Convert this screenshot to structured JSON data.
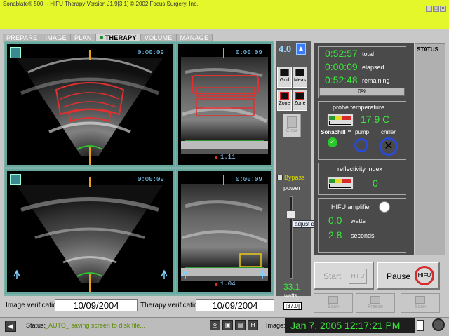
{
  "window": {
    "title": "Sonablate® 500 -- HIFU Therapy  Version J1.9[3.1]  © 2002 Focus Surgery, Inc.",
    "controls": [
      "_",
      "□",
      "×"
    ]
  },
  "tabs": [
    {
      "label": "PREPARE",
      "active": false
    },
    {
      "label": "IMAGE",
      "active": false
    },
    {
      "label": "PLAN",
      "active": false
    },
    {
      "label": "THERAPY",
      "active": true
    },
    {
      "label": "VOLUME",
      "active": false
    },
    {
      "label": "MANAGE",
      "active": false
    }
  ],
  "views": {
    "top_left": {
      "timer": "0:00:09"
    },
    "top_right": {
      "timer": "0:00:09",
      "depth": "1.11"
    },
    "bottom_left": {
      "timer": "0:00:09"
    },
    "bottom_right": {
      "timer": "0:00:09",
      "depth": "1.04"
    }
  },
  "tools": {
    "scale": "4.0",
    "grid_label": "Grid",
    "meas_label": "Meas",
    "zone1_label": "Zone",
    "zone2_label": "Zone",
    "clear_label": "Clear",
    "bypass_label": "Bypass",
    "power_label": "power",
    "power_value": "33.1",
    "watts_label": "watts",
    "power_setting": "[37.0]",
    "slider_level_percent": 81,
    "tooltip": "adjust dosage"
  },
  "verification": {
    "image_label": "Image verification",
    "image_date": "10/09/2004",
    "therapy_label": "Therapy verification",
    "therapy_date": "10/09/2004"
  },
  "timing": {
    "total_time": "0:52:57",
    "total_label": "total",
    "elapsed_time": "0:00:09",
    "elapsed_label": "elapsed",
    "remaining_time": "0:52:48",
    "remaining_label": "remaining",
    "progress_text": "0%",
    "progress_percent": 0
  },
  "probe": {
    "title": "probe temperature",
    "temperature": "17.9 C",
    "sonachill_label": "Sonachill™",
    "pump_label": "pump",
    "chiller_label": "chiller"
  },
  "reflectivity": {
    "title": "reflectivity index",
    "value": "0"
  },
  "hifu": {
    "title": "HIFU amplifier",
    "watts_value": "0.0",
    "watts_label": "watts",
    "seconds_value": "2.8",
    "seconds_label": "seconds"
  },
  "status_panel": {
    "title": "STATUS"
  },
  "actions": {
    "start_label": "Start",
    "start_icon_text": "HIFU",
    "pause_label": "Pause",
    "pause_icon_text": "HIFU",
    "scan1_label": "Scan",
    "freeze_label": "Freeze",
    "scan2_label": "Scan"
  },
  "statusbar": {
    "status_label": "Status:",
    "status_message": "_AUTO_ saving screen to disk file...",
    "image_label": "Image:",
    "image_time": "Jan 7, 2005 12:17:21 PM"
  },
  "colors": {
    "title_bar": "#e3f72a",
    "accent_green": "#3bea3b",
    "panel_teal": "#7fb3a8",
    "target_red": "#e03030"
  }
}
